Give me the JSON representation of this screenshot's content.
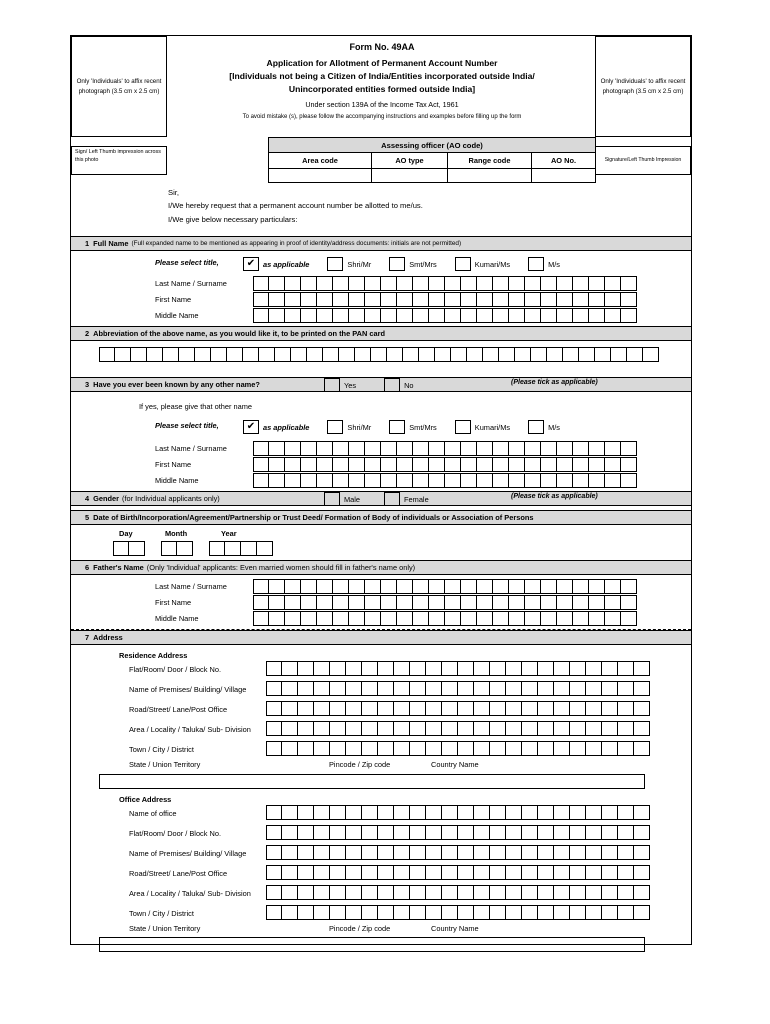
{
  "photo_left": "Only 'Individuals' to affix recent photograph (3.5 cm x 2.5 cm)",
  "photo_right": "Only 'Individuals' to affix recent photograph (3.5 cm x 2.5 cm)",
  "sign_left": "Sign/ Left Thumb impression across this photo",
  "sign_right": "Signature/Left Thumb Impression",
  "header": {
    "form_no": "Form No. 49AA",
    "title": "Application for Allotment of Permanent Account Number",
    "subtitle1": "[Individuals not being a Citizen of India/Entities incorporated outside India/",
    "subtitle2": "Unincorporated entities formed outside India]",
    "section": "Under section 139A of the Income Tax Act, 1961",
    "note": "To avoid mistake (s), please follow the accompanying instructions and examples before filling up the form"
  },
  "ao": {
    "heading": "Assessing officer (AO code)",
    "columns": [
      "Area code",
      "AO type",
      "Range code",
      "AO No."
    ]
  },
  "intro": {
    "line1": "Sir,",
    "line2": "I/We hereby request that a permanent account number be allotted to me/us.",
    "line3": "I/We give below necessary particulars:"
  },
  "section1": {
    "num": "1",
    "title": "Full Name",
    "hint": "(Full expanded name to be mentioned as appearing in proof of identity/address documents: initials are not permitted)",
    "select_title": "Please select title,",
    "as_applicable": "as applicable",
    "titles": [
      "Shri/Mr",
      "Smt/Mrs",
      "Kumari/Ms",
      "M/s"
    ],
    "rows": [
      "Last Name / Surname",
      "First Name",
      "Middle Name"
    ],
    "checked": "✔"
  },
  "section2": {
    "num": "2",
    "title": "Abbreviation of the above name, as you would like it, to be printed on the PAN card"
  },
  "section3": {
    "num": "3",
    "title": "Have you ever been known by any other name?",
    "yes": "Yes",
    "no": "No",
    "tick_note": "(Please tick as applicable)",
    "ifyes": "If yes, please give that other name",
    "select_title": "Please select title,",
    "as_applicable": "as applicable",
    "titles": [
      "Shri/Mr",
      "Smt/Mrs",
      "Kumari/Ms",
      "M/s"
    ],
    "rows": [
      "Last Name / Surname",
      "First Name",
      "Middle Name"
    ],
    "checked": "✔"
  },
  "section4": {
    "num": "4",
    "title": "Gender",
    "hint": "(for Individual applicants only)",
    "male": "Male",
    "female": "Female",
    "tick_note": "(Please tick as applicable)"
  },
  "section5": {
    "num": "5",
    "title": "Date of Birth/Incorporation/Agreement/Partnership or Trust Deed/ Formation of Body of individuals or Association of Persons",
    "day": "Day",
    "month": "Month",
    "year": "Year"
  },
  "section6": {
    "num": "6",
    "title": "Father's Name",
    "hint": "(Only 'Individual' applicants: Even married women should fill in father's name only)",
    "rows": [
      "Last Name / Surname",
      "First Name",
      "Middle Name"
    ]
  },
  "section7": {
    "num": "7",
    "title": "Address",
    "residence_heading": "Residence Address",
    "office_heading": "Office Address",
    "residence_rows": [
      "Flat/Room/ Door / Block No.",
      "Name of Premises/ Building/ Village",
      "Road/Street/ Lane/Post Office",
      "Area / Locality / Taluka/ Sub- Division",
      "Town / City / District",
      "State / Union Territory"
    ],
    "office_name_row": "Name of office",
    "office_rows": [
      "Flat/Room/ Door / Block No.",
      "Name of Premises/ Building/ Village",
      "Road/Street/ Lane/Post Office",
      "Area / Locality / Taluka/ Sub- Division",
      "Town / City / District",
      "State / Union Territory"
    ],
    "pincode": "Pincode / Zip code",
    "country": "Country Name"
  }
}
